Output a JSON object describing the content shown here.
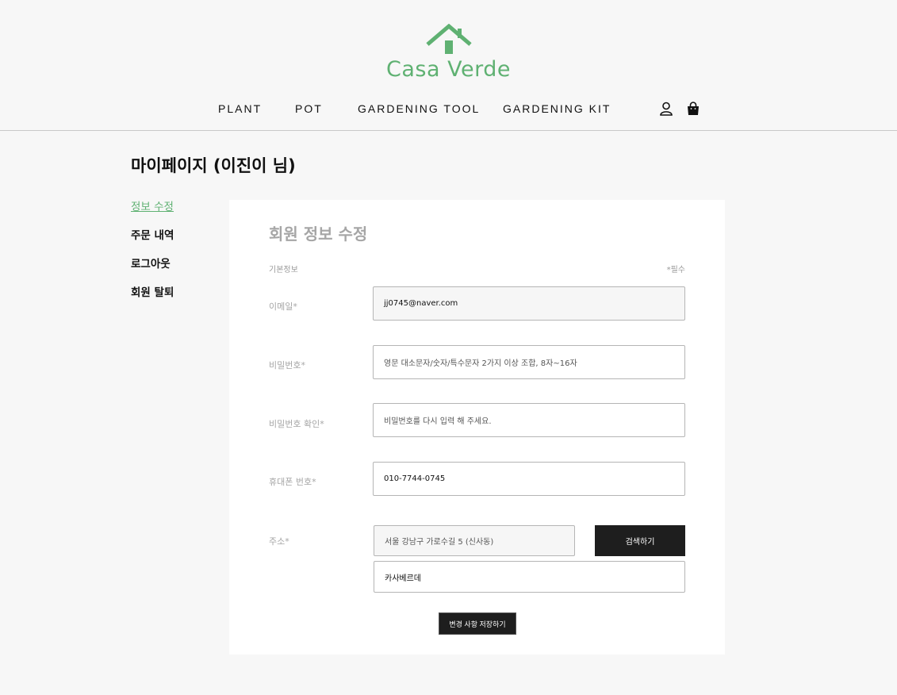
{
  "brand": {
    "name": "Casa Verde",
    "color": "#5fb172",
    "logo_icon": "house-icon"
  },
  "nav": {
    "items": [
      "PLANT",
      "POT",
      "GARDENING TOOL",
      "GARDENING KIT"
    ],
    "icons": [
      "user-icon",
      "shopping-bag-icon"
    ]
  },
  "page": {
    "title": "마이페이지 (이진이 님)"
  },
  "side_menu": {
    "items": [
      "정보 수정",
      "주문 내역",
      "로그아웃",
      "회원 탈퇴"
    ],
    "active_index": 0
  },
  "form": {
    "title": "회원 정보 수정",
    "section_label": "기본정보",
    "required_note": "*필수",
    "email": {
      "label": "이메일*",
      "value": "jj0745@naver.com"
    },
    "password": {
      "label": "비밀번호*",
      "placeholder": "영문 대소문자/숫자/특수문자 2가지 이상 조합, 8자~16자"
    },
    "password_confirm": {
      "label": "비밀번호 확인*",
      "placeholder": "비밀번호를 다시 입력 해 주세요."
    },
    "phone": {
      "label": "휴대폰 번호*",
      "value": "010-7744-0745"
    },
    "address": {
      "label": "주소*",
      "main_value": "서울 강남구 가로수길 5 (신사동)",
      "detail_value": "카사베르데",
      "search_button": "검색하기"
    },
    "save_button": "변경 사항 저장하기"
  }
}
